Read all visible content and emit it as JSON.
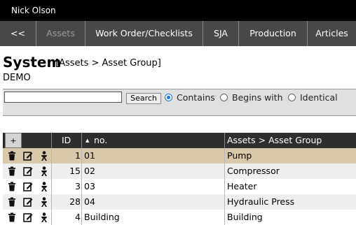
{
  "header": {
    "user": "Nick Olson"
  },
  "nav": {
    "tabs": [
      {
        "label": "<<"
      },
      {
        "label": "Assets"
      },
      {
        "label": "Work Order/Checklists"
      },
      {
        "label": "SJA"
      },
      {
        "label": "Production"
      },
      {
        "label": "Articles"
      }
    ]
  },
  "page": {
    "title": "System",
    "breadcrumb": "[Assets > Asset Group]",
    "subtitle": "DEMO"
  },
  "search": {
    "value": "",
    "button_label": "Search",
    "options": [
      {
        "label": "Contains",
        "checked": true
      },
      {
        "label": "Begins with",
        "checked": false
      },
      {
        "label": "Identical",
        "checked": false
      }
    ]
  },
  "table": {
    "add_label": "+",
    "columns": {
      "id": "ID",
      "no": "no.",
      "group": "Assets > Asset Group"
    },
    "sort_indicator": "▲",
    "rows": [
      {
        "id": "1",
        "no": "01",
        "group": "Pump"
      },
      {
        "id": "15",
        "no": "02",
        "group": "Compressor"
      },
      {
        "id": "3",
        "no": "03",
        "group": "Heater"
      },
      {
        "id": "28",
        "no": "04",
        "group": "Hydraulic Press"
      },
      {
        "id": "4",
        "no": "Building",
        "group": "Building"
      }
    ]
  }
}
